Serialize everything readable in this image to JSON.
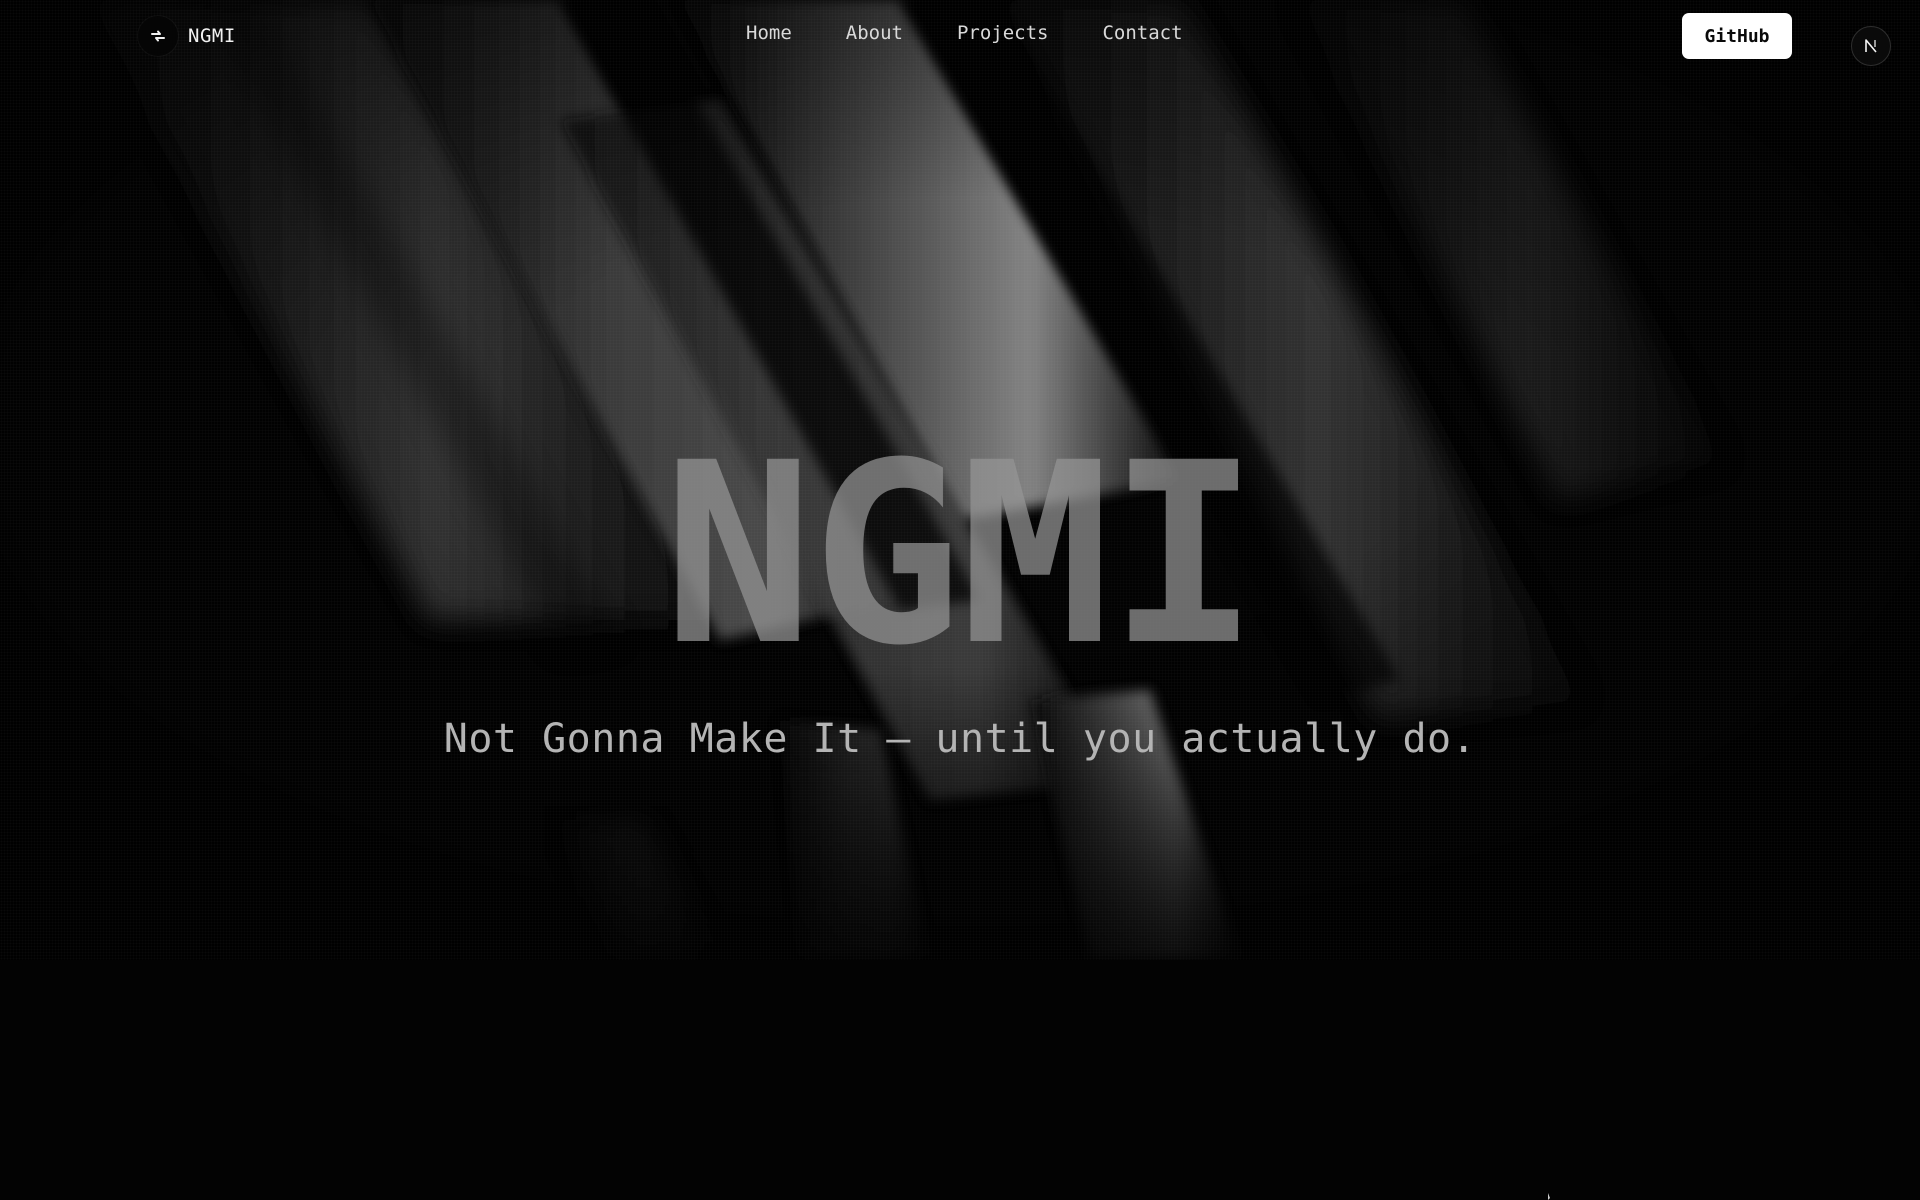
{
  "brand": {
    "name": "NGMI",
    "logo_icon": "bolt-arrows-icon"
  },
  "nav": {
    "links": [
      {
        "label": "Home"
      },
      {
        "label": "About"
      },
      {
        "label": "Projects"
      },
      {
        "label": "Contact"
      }
    ],
    "github_label": "GitHub"
  },
  "badge": {
    "letter": "N",
    "icon": "nextjs-badge-icon"
  },
  "hero": {
    "title": "NGMI",
    "subtitle": "Not Gonna Make It — until you actually do."
  },
  "colors": {
    "background": "#030303",
    "accent": "#ffffff",
    "title": "#969696",
    "subtitle": "#b4b4b4"
  }
}
